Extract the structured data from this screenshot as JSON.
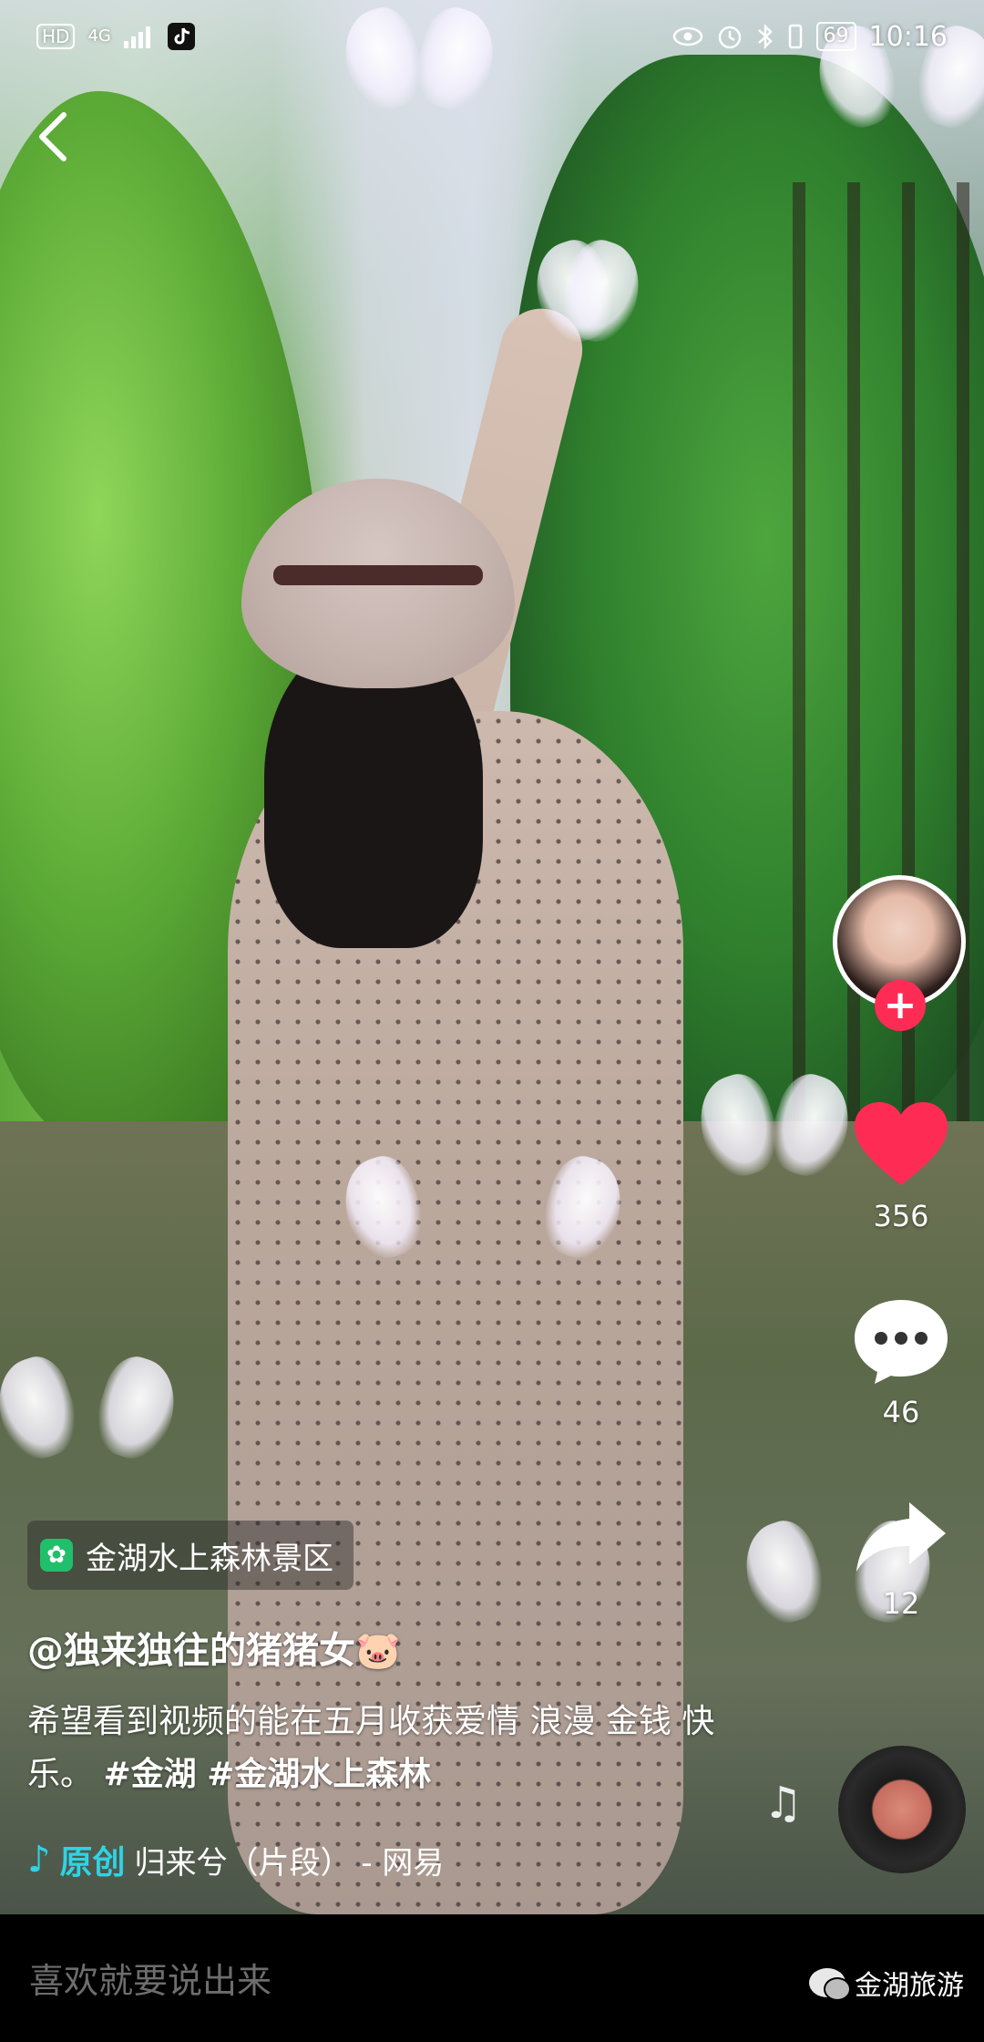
{
  "status_bar": {
    "hd": "HD",
    "network": "4G",
    "time": "10:16",
    "battery": "69"
  },
  "location": {
    "name": "金湖水上森林景区"
  },
  "author": {
    "handle": "@独来独往的猪猪女🐷"
  },
  "description": {
    "text": "希望看到视频的能在五月收获爱情 浪漫 金钱 快乐。",
    "hashtags": [
      "#金湖",
      "#金湖水上森林"
    ]
  },
  "music": {
    "original_label": "原创",
    "title": "归来兮（片段） - 网易"
  },
  "actions": {
    "likes": "356",
    "comments": "46",
    "shares": "12"
  },
  "comment_input": {
    "placeholder": "喜欢就要说出来"
  },
  "watermark": {
    "text": "金湖旅游"
  },
  "colors": {
    "like": "#fe2c55",
    "follow": "#fe2c55",
    "music_accent": "#2fd3e6",
    "location_icon": "#1fbf6b"
  },
  "icons": [
    "back-icon",
    "heart-icon",
    "comment-bubble-icon",
    "share-arrow-icon",
    "music-note-icon",
    "location-icon",
    "plus-icon",
    "eye-icon",
    "alarm-icon",
    "bluetooth-icon",
    "wechat-icon"
  ]
}
